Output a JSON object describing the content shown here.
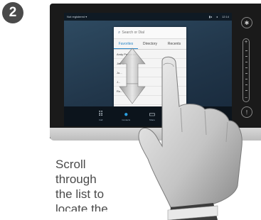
{
  "step": {
    "number": "2"
  },
  "status_bar": {
    "left_text": "Not registered ▾",
    "right_text": "12:14"
  },
  "search": {
    "placeholder": "Search or Dial"
  },
  "tabs": [
    {
      "label": "Favorites",
      "active": true
    },
    {
      "label": "Directory",
      "active": false
    },
    {
      "label": "Recents",
      "active": false
    }
  ],
  "list_items": [
    "Andy Pescenko",
    "Jim ...",
    "Jo...",
    "J...",
    "Ro..."
  ],
  "bottom_nav": [
    {
      "label": "Call",
      "icon": "keypad-icon"
    },
    {
      "label": "Contacts",
      "icon": "person-icon",
      "active": true
    },
    {
      "label": "Share",
      "icon": "share-icon"
    }
  ],
  "side": {
    "vol_plus": "+",
    "vol_minus": "−"
  },
  "instruction": {
    "lines": [
      "Scroll",
      "through",
      "the list to",
      "locate the"
    ]
  },
  "colors": {
    "accent": "#2a87c8",
    "screen": "#21364a",
    "bezel": "#1a1a1a",
    "text": "#4a4a4a"
  }
}
